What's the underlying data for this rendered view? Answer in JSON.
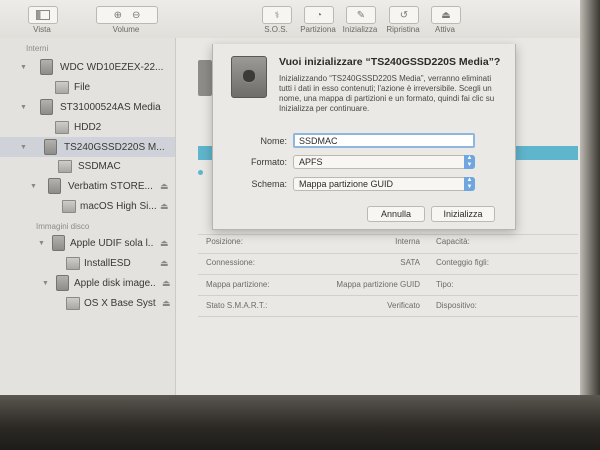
{
  "toolbar": {
    "vista_label": "Vista",
    "volume_label": "Volume",
    "actions": [
      {
        "label": "S.O.S."
      },
      {
        "label": "Partiziona"
      },
      {
        "label": "Inizializza"
      },
      {
        "label": "Ripristina"
      },
      {
        "label": "Attiva"
      }
    ],
    "sos_icon_text": "꧞"
  },
  "sidebar": {
    "internal_header": "Interni",
    "image_header": "Immagini disco",
    "items": [
      {
        "label": "WDC WD10EZEX-22..."
      },
      {
        "label": "File"
      },
      {
        "label": "ST31000524AS Media"
      },
      {
        "label": "HDD2"
      },
      {
        "label": "TS240GSSD220S M..."
      },
      {
        "label": "SSDMAC"
      },
      {
        "label": "Verbatim STORE..."
      },
      {
        "label": "macOS High Si..."
      },
      {
        "label": "Apple UDIF sola l..."
      },
      {
        "label": "InstallESD"
      },
      {
        "label": "Apple disk image..."
      },
      {
        "label": "OS X Base Syst..."
      }
    ]
  },
  "dialog": {
    "title": "Vuoi inizializzare “TS240GSSD220S Media”?",
    "description": "Inizializzando “TS240GSSD220S Media”, verranno eliminati tutti i dati in esso contenuti; l'azione è irreversibile. Scegli un nome, una mappa di partizioni e un formato, quindi fai clic su Inizializza per continuare.",
    "name_label": "Nome:",
    "name_value": "SSDMAC",
    "format_label": "Formato:",
    "format_value": "APFS",
    "scheme_label": "Schema:",
    "scheme_value": "Mappa partizione GUID",
    "cancel_label": "Annulla",
    "erase_label": "Inizializza"
  },
  "info": {
    "rows": [
      {
        "key": "Posizione:",
        "value": "Interna",
        "key2": "Capacità:"
      },
      {
        "key": "Connessione:",
        "value": "SATA",
        "key2": "Conteggio figli:"
      },
      {
        "key": "Mappa partizione:",
        "value": "Mappa partizione GUID",
        "key2": "Tipo:"
      },
      {
        "key": "Stato S.M.A.R.T.:",
        "value": "Verificato",
        "key2": "Dispositivo:"
      }
    ]
  },
  "colors": {
    "accent": "#6fa6e0",
    "capacity_bar": "#5fb5cc"
  }
}
